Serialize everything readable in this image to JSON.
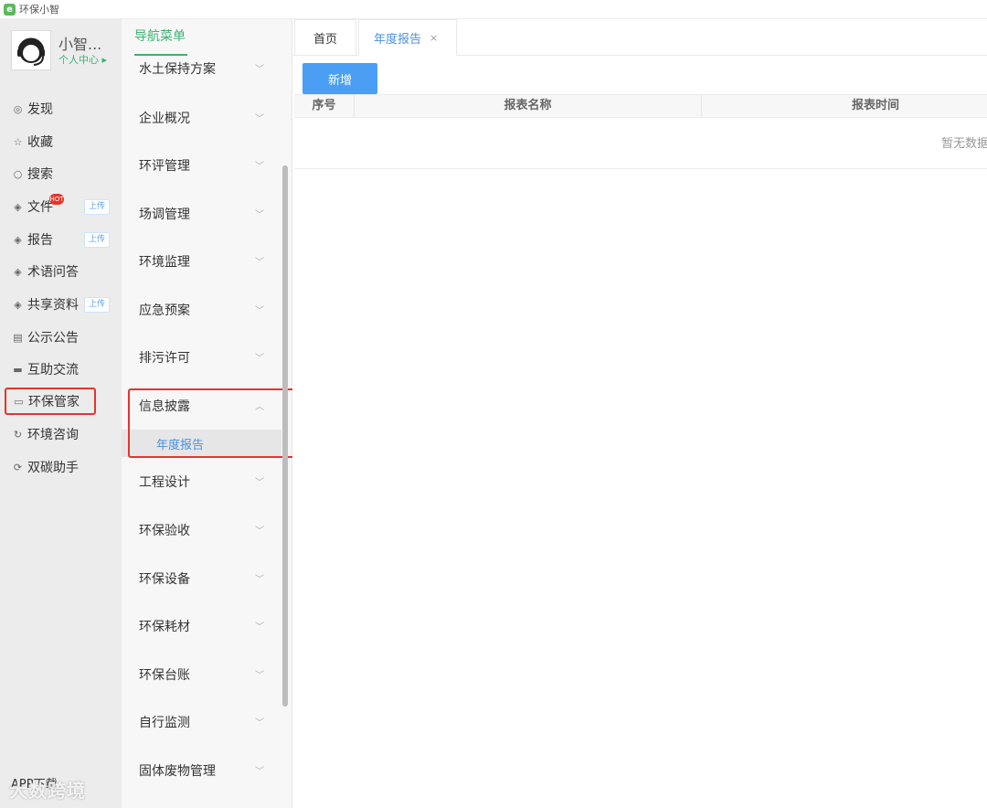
{
  "app": {
    "title": "环保小智",
    "logo_glyph": "e"
  },
  "profile": {
    "name": "小智...",
    "link": "个人中心 ▸"
  },
  "left_menu": [
    {
      "label": "发现",
      "icon": "eye-icon",
      "glyph": "◎"
    },
    {
      "label": "收藏",
      "icon": "star-icon",
      "glyph": "☆"
    },
    {
      "label": "搜索",
      "icon": "search-icon",
      "glyph": "○"
    },
    {
      "label": "文件",
      "icon": "layers-icon",
      "glyph": "◈",
      "badge": "HOT",
      "tag": "上传"
    },
    {
      "label": "报告",
      "icon": "layers-icon",
      "glyph": "◈",
      "tag": "上传"
    },
    {
      "label": "术语问答",
      "icon": "layers-icon",
      "glyph": "◈"
    },
    {
      "label": "共享资料",
      "icon": "layers-icon",
      "glyph": "◈",
      "tag": "上传"
    },
    {
      "label": "公示公告",
      "icon": "notice-icon",
      "glyph": "▤"
    },
    {
      "label": "互助交流",
      "icon": "chat-icon",
      "glyph": "▬"
    },
    {
      "label": "环保管家",
      "icon": "monitor-icon",
      "glyph": "▭"
    },
    {
      "label": "环境咨询",
      "icon": "refresh-icon",
      "glyph": "↻"
    },
    {
      "label": "双碳助手",
      "icon": "cycle-icon",
      "glyph": "⟳"
    }
  ],
  "app_download": "APP下载",
  "watermark": "大数跨境",
  "nav": {
    "header": "导航菜单",
    "items": [
      {
        "label": "水土保持方案",
        "chevron": "﹀"
      },
      {
        "label": "企业概况",
        "chevron": "﹀"
      },
      {
        "label": "环评管理",
        "chevron": "﹀"
      },
      {
        "label": "场调管理",
        "chevron": "﹀"
      },
      {
        "label": "环境监理",
        "chevron": "﹀"
      },
      {
        "label": "应急预案",
        "chevron": "﹀"
      },
      {
        "label": "排污许可",
        "chevron": "﹀"
      },
      {
        "label": "信息披露",
        "chevron": "︿"
      },
      {
        "label": "工程设计",
        "chevron": "﹀"
      },
      {
        "label": "环保验收",
        "chevron": "﹀"
      },
      {
        "label": "环保设备",
        "chevron": "﹀"
      },
      {
        "label": "环保耗材",
        "chevron": "﹀"
      },
      {
        "label": "环保台账",
        "chevron": "﹀"
      },
      {
        "label": "自行监测",
        "chevron": "﹀"
      },
      {
        "label": "固体废物管理",
        "chevron": "﹀"
      }
    ],
    "sub_item": "年度报告"
  },
  "tabs": {
    "home": "首页",
    "active": "年度报告",
    "close": "×"
  },
  "toolbar": {
    "add": "新增"
  },
  "table": {
    "headers": [
      "序号",
      "报表名称",
      "报表时间"
    ],
    "empty": "暂无数据"
  },
  "colors": {
    "accent_green": "#3cb371",
    "accent_blue": "#4a9ff5",
    "highlight_red": "#e5352d"
  }
}
